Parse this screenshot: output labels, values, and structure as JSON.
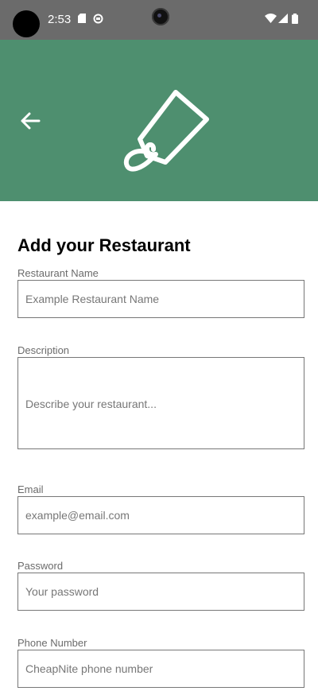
{
  "status_bar": {
    "time": "2:53"
  },
  "header": {
    "background_color": "#4e8f6f",
    "back_icon": "arrow-left-icon",
    "logo_icon": "price-tag-icon"
  },
  "form": {
    "title": "Add your Restaurant",
    "fields": [
      {
        "label": "Restaurant Name",
        "placeholder": "Example Restaurant Name"
      },
      {
        "label": "Description",
        "placeholder": "Describe your restaurant..."
      },
      {
        "label": "Email",
        "placeholder": "example@email.com"
      },
      {
        "label": "Password",
        "placeholder": "Your password"
      },
      {
        "label": "Phone Number",
        "placeholder": "CheapNite phone number"
      }
    ]
  }
}
